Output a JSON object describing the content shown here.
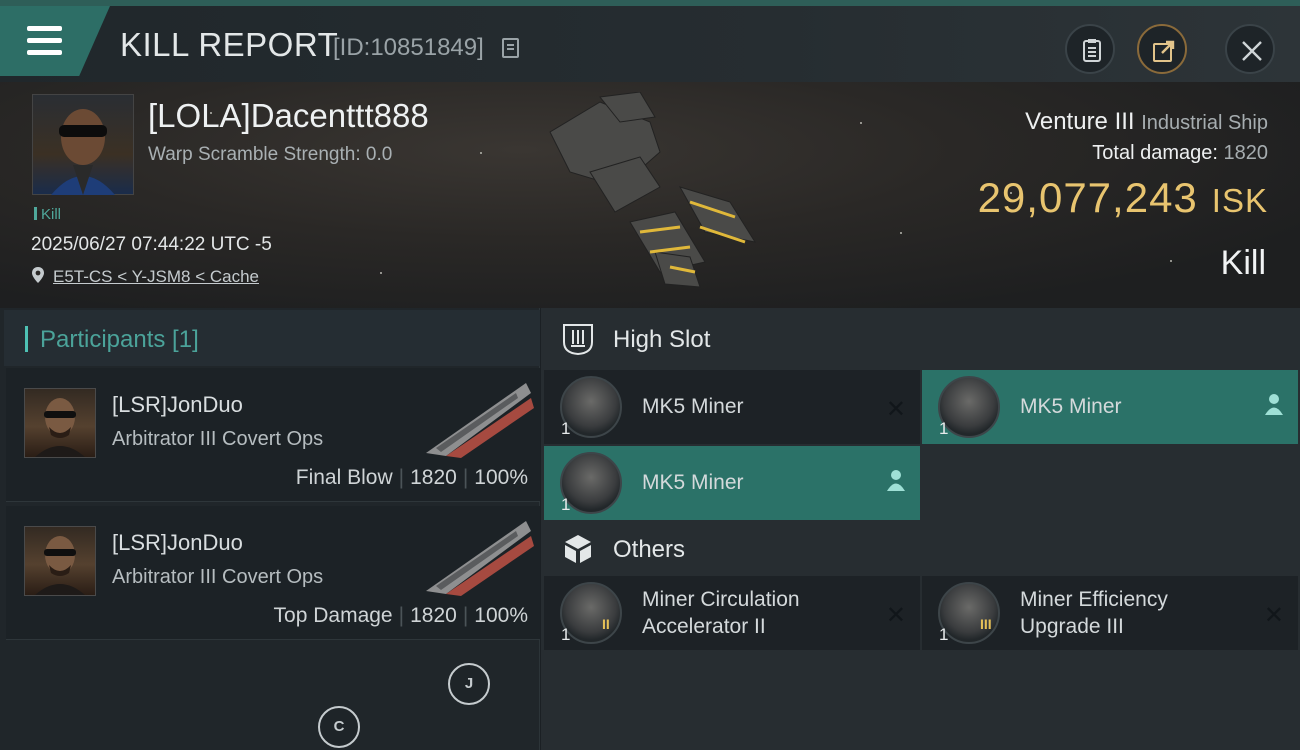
{
  "header": {
    "title": "KILL REPORT",
    "report_id": "[ID:10851849]"
  },
  "victim": {
    "name": "[LOLA]Dacenttt888",
    "warp_scramble": "Warp Scramble Strength: 0.0",
    "tag": "Kill",
    "datetime": "2025/06/27 07:44:22 UTC -5",
    "location": "E5T-CS < Y-JSM8 < Cache",
    "ship_name": "Venture III",
    "ship_class": "Industrial Ship",
    "total_damage_label": "Total damage:",
    "total_damage": "1820",
    "isk_value": "29,077,243",
    "isk_unit": "ISK",
    "result": "Kill"
  },
  "participants": {
    "header": "Participants [1]",
    "items": [
      {
        "name": "[LSR]JonDuo",
        "ship": "Arbitrator III Covert Ops",
        "role": "Final Blow",
        "damage": "1820",
        "percent": "100%"
      },
      {
        "name": "[LSR]JonDuo",
        "ship": "Arbitrator III Covert Ops",
        "role": "Top Damage",
        "damage": "1820",
        "percent": "100%"
      }
    ]
  },
  "markers": {
    "j": "J",
    "c": "C"
  },
  "fitting": {
    "high_slot_title": "High Slot",
    "high_slots": [
      {
        "name": "MK5 Miner",
        "qty": "1",
        "state": "destroyed"
      },
      {
        "name": "MK5 Miner",
        "qty": "1",
        "state": "dropped"
      },
      {
        "name": "MK5 Miner",
        "qty": "1",
        "state": "dropped"
      }
    ],
    "others_title": "Others",
    "others": [
      {
        "name": "Miner Circulation Accelerator II",
        "line1": "Miner Circulation",
        "line2": "Accelerator II",
        "qty": "1",
        "tier": "II",
        "state": "destroyed"
      },
      {
        "name": "Miner Efficiency Upgrade III",
        "line1": "Miner Efficiency",
        "line2": "Upgrade III",
        "qty": "1",
        "tier": "III",
        "state": "destroyed"
      }
    ]
  },
  "icons": {
    "menu": "hamburger-icon",
    "copy": "copy-icon",
    "notes": "clipboard-icon",
    "share": "share-icon",
    "close": "close-icon",
    "location": "location-pin-icon",
    "high_slot": "high-slot-icon",
    "others": "cube-icon",
    "destroyed": "x-icon",
    "dropped": "pilot-icon"
  },
  "colors": {
    "accent": "#2b7268",
    "isk": "#e8c46f",
    "participants_header": "#4ba39a"
  }
}
